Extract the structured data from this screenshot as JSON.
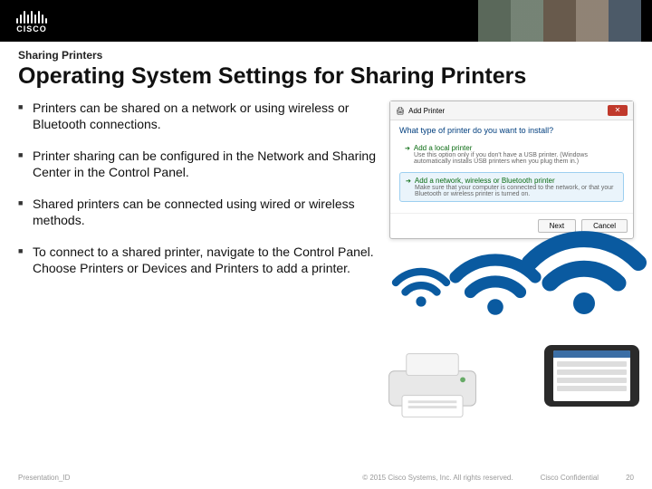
{
  "logo_text": "CISCO",
  "header": {
    "kicker": "Sharing Printers",
    "title": "Operating System Settings for Sharing Printers"
  },
  "bullets": [
    "Printers can be shared on a network or using wireless or Bluetooth connections.",
    "Printer sharing can be configured in the Network and Sharing Center in the Control Panel.",
    "Shared printers can be connected using wired or wireless methods.",
    "To connect to a shared printer, navigate to the Control Panel. Choose Printers or Devices and Printers to add a printer."
  ],
  "dialog": {
    "title": "Add Printer",
    "question": "What type of printer do you want to install?",
    "options": [
      {
        "title": "Add a local printer",
        "desc": "Use this option only if you don't have a USB printer. (Windows automatically installs USB printers when you plug them in.)"
      },
      {
        "title": "Add a network, wireless or Bluetooth printer",
        "desc": "Make sure that your computer is connected to the network, or that your Bluetooth or wireless printer is turned on."
      }
    ],
    "buttons": {
      "next": "Next",
      "cancel": "Cancel"
    }
  },
  "footer": {
    "left": "Presentation_ID",
    "copyright": "© 2015 Cisco Systems, Inc. All rights reserved.",
    "confidential": "Cisco Confidential",
    "page": "20"
  }
}
